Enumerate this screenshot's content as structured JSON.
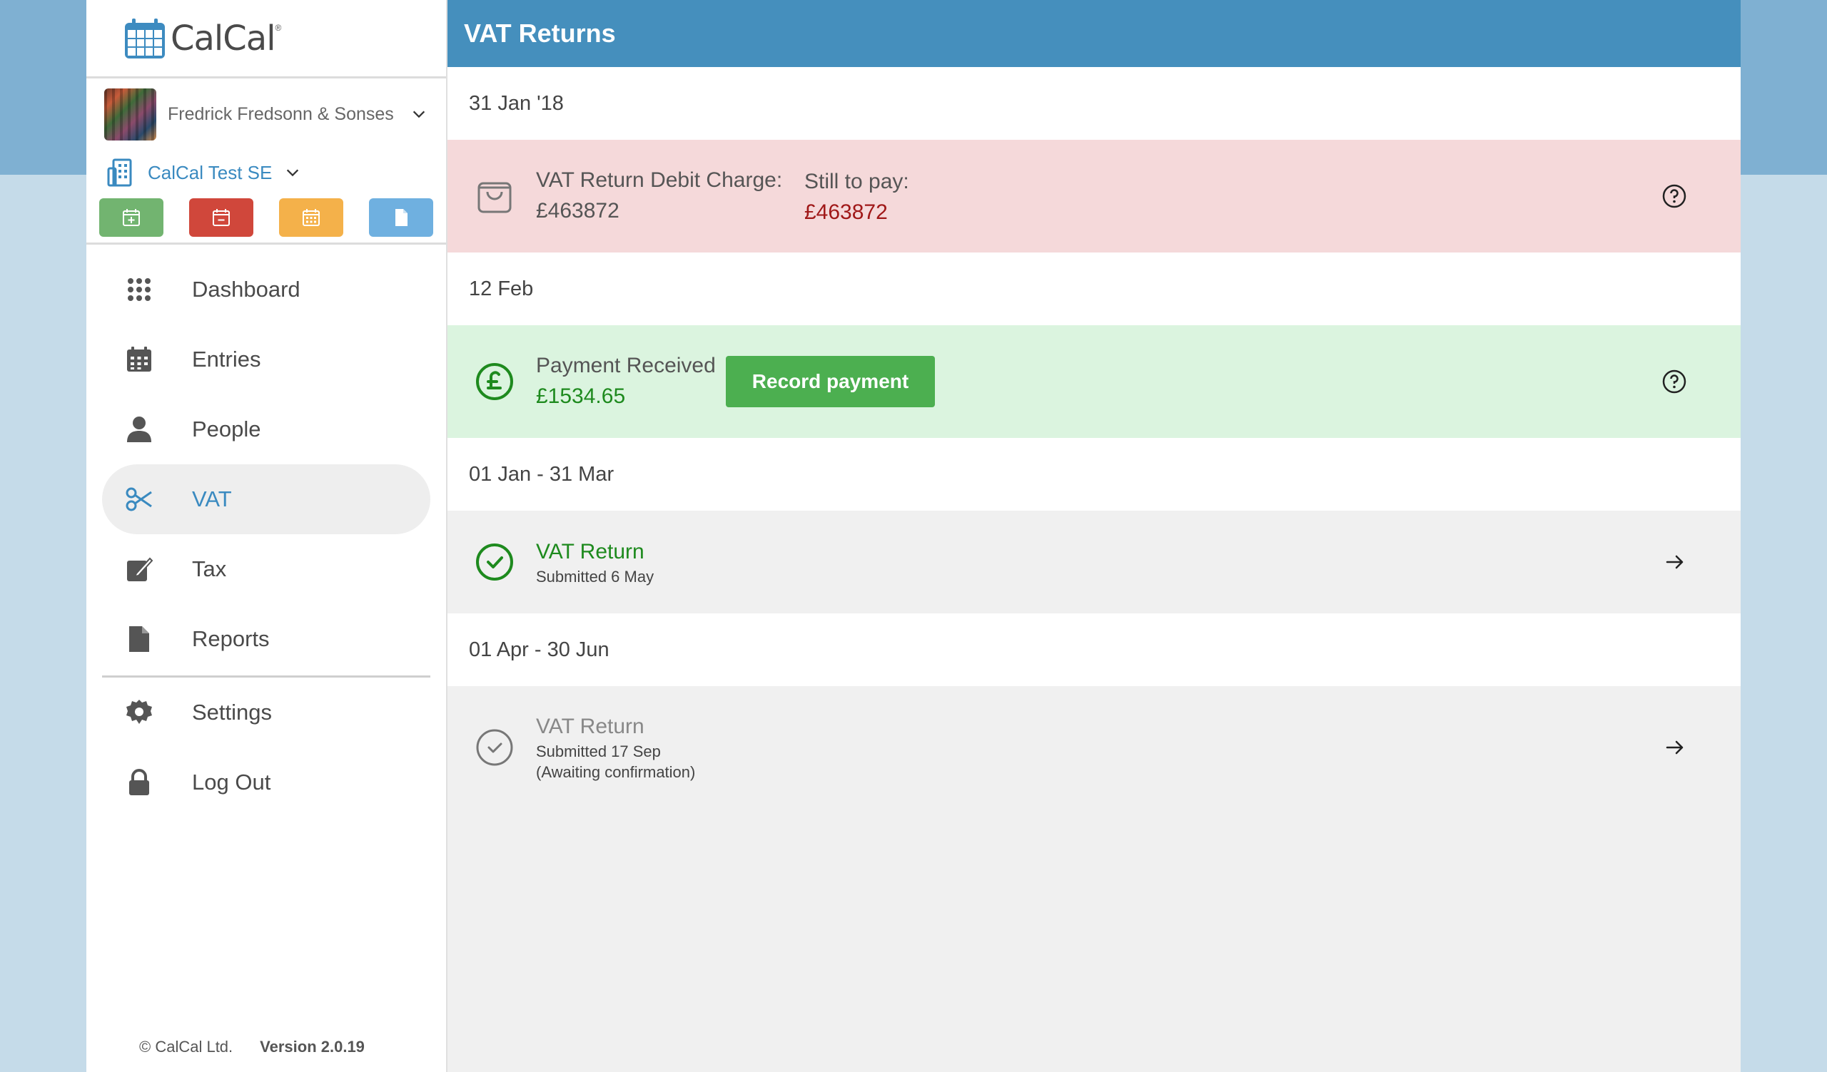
{
  "brand": {
    "name": "CalCal",
    "reg": "®",
    "accent": "#3a8ac0"
  },
  "company": {
    "name": "Fredrick Fredsonn & Sonses",
    "chevron_icon": "chevron-down-icon"
  },
  "entity": {
    "name": "CalCal Test SE",
    "icon": "building-icon"
  },
  "quick_actions": [
    {
      "name": "add-entry",
      "icon": "calendar-plus-icon",
      "color": "#72b470"
    },
    {
      "name": "remove-entry",
      "icon": "calendar-minus-icon",
      "color": "#d0473b"
    },
    {
      "name": "calendar",
      "icon": "calendar-icon",
      "color": "#f4b14a"
    },
    {
      "name": "document",
      "icon": "document-icon",
      "color": "#6fb0e0"
    }
  ],
  "nav": {
    "items": [
      {
        "label": "Dashboard",
        "icon": "grid-icon"
      },
      {
        "label": "Entries",
        "icon": "calendar-icon"
      },
      {
        "label": "People",
        "icon": "person-icon"
      },
      {
        "label": "VAT",
        "icon": "scissors-icon",
        "active": true
      },
      {
        "label": "Tax",
        "icon": "edit-icon"
      },
      {
        "label": "Reports",
        "icon": "document-icon"
      }
    ],
    "settings_label": "Settings",
    "logout_label": "Log Out"
  },
  "footer": {
    "copyright": "© CalCal Ltd.",
    "version": "Version 2.0.19"
  },
  "header": {
    "title": "VAT Returns"
  },
  "sections": {
    "s1": {
      "date": "31 Jan '18",
      "label": "VAT Return Debit Charge:",
      "amount": "£463872",
      "still_label": "Still to pay:",
      "still_amount": "£463872",
      "icon": "shopping-bag-icon"
    },
    "s2": {
      "date": "12 Feb",
      "label": "Payment Received",
      "amount": "£1534.65",
      "button": "Record payment",
      "icon": "pound-circle-icon"
    },
    "s3": {
      "date": "01 Jan - 31 Mar",
      "title": "VAT Return",
      "sub": "Submitted 6 May",
      "icon": "check-circle-icon"
    },
    "s4": {
      "date": "01 Apr - 30 Jun",
      "title": "VAT Return",
      "sub": "Submitted 17 Sep",
      "sub2": "(Awaiting confirmation)",
      "icon": "check-circle-icon"
    }
  },
  "colors": {
    "header": "#458fbd",
    "debit_bg": "#f5d9da",
    "payment_bg": "#dbf4df",
    "success": "#1e8a1e",
    "danger": "#a01818"
  }
}
